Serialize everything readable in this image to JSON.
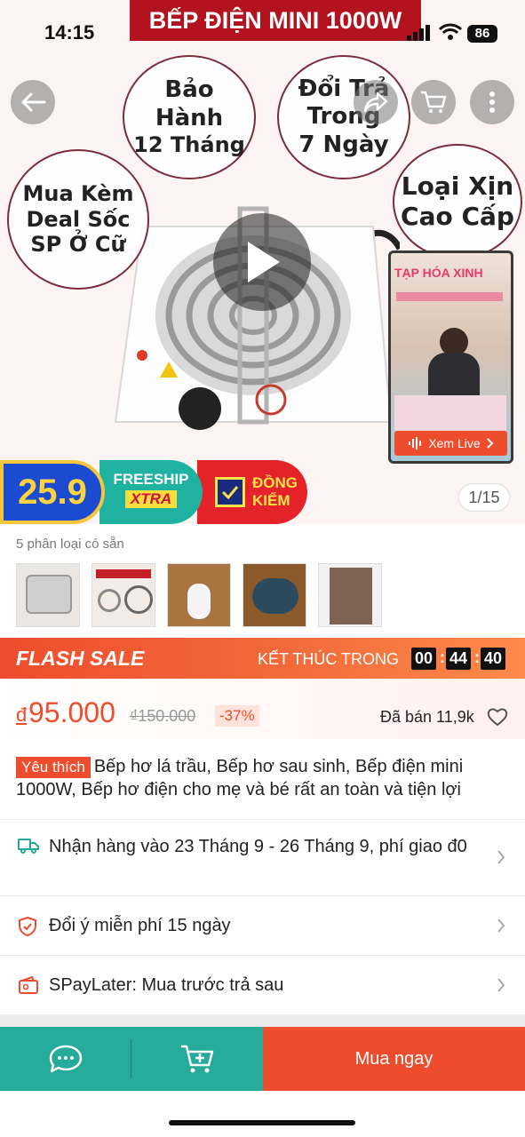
{
  "status": {
    "time": "14:15",
    "battery": "86"
  },
  "hero": {
    "banner": "BẾP ĐIỆN MINI 1000W",
    "bubbles": {
      "warranty": [
        "Bảo",
        "Hành",
        "12 Tháng"
      ],
      "exchange": [
        "Đổi Trả",
        "Trong",
        "7 Ngày"
      ],
      "combo": [
        "Mua Kèm",
        "Deal Sốc",
        "SP Ở Cữ"
      ],
      "quality": [
        "Loại Xịn",
        "Cao Cấp"
      ]
    },
    "live": {
      "shop": "TẠP HÓA XINH",
      "button": "Xem Live"
    },
    "promo": {
      "date": "25.9",
      "freeship": "FREESHIP",
      "xtra": "XTRA",
      "dongkiem": [
        "ĐỒNG",
        "KIỂM"
      ]
    },
    "counter": "1/15"
  },
  "variants": {
    "label": "5 phân loại có sẵn"
  },
  "flash": {
    "title": "FLASH SALE",
    "ends_label": "KẾT THÚC TRONG",
    "hh": "00",
    "mm": "44",
    "ss": "40"
  },
  "price": {
    "currency": "đ",
    "current": "95.000",
    "original": "₫150.000",
    "discount": "-37%",
    "sold": "Đã bán 11,9k"
  },
  "product": {
    "tag": "Yêu thích",
    "title": "Bếp hơ lá trầu, Bếp hơ sau sinh, Bếp điện mini 1000W, Bếp hơ điện cho mẹ và bé rất an toàn và tiện lợi"
  },
  "rows": {
    "shipping": "Nhận hàng vào 23 Tháng 9 - 26 Tháng 9, phí giao đ0",
    "returns": "Đổi ý miễn phí 15 ngày",
    "paylater": "SPayLater: Mua trước trả sau"
  },
  "bottom": {
    "buy": "Mua ngay"
  },
  "colors": {
    "accent": "#ee4d2d",
    "teal": "#26aa99"
  }
}
